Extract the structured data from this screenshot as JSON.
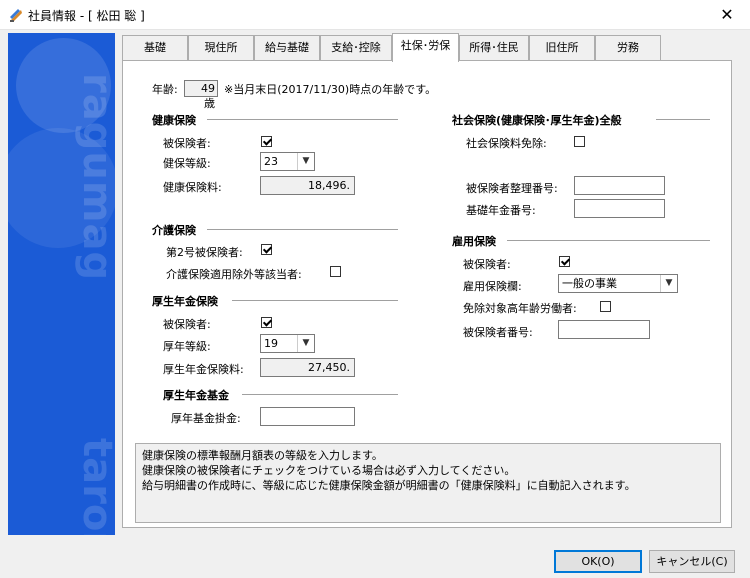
{
  "window": {
    "title": "社員情報 - [ 松田 聡 ]"
  },
  "tabs": [
    "基礎",
    "現住所",
    "給与基礎",
    "支給･控除",
    "社保･労保",
    "所得･住民",
    "旧住所",
    "労務"
  ],
  "age": {
    "label": "年齢:",
    "value": "49",
    "unit": "歳",
    "note": "※当月末日(2017/11/30)時点の年齢です。"
  },
  "health": {
    "title": "健康保険",
    "insured_label": "被保険者:",
    "grade_label": "健保等級:",
    "grade_value": "23",
    "premium_label": "健康保険料:",
    "premium_value": "18,496."
  },
  "care": {
    "title": "介護保険",
    "type2_label": "第2号被保険者:",
    "exempt_label": "介護保険適用除外等該当者:"
  },
  "pension": {
    "title": "厚生年金保険",
    "insured_label": "被保険者:",
    "grade_label": "厚年等級:",
    "grade_value": "19",
    "premium_label": "厚生年金保険料:",
    "premium_value": "27,450."
  },
  "fund": {
    "title": "厚生年金基金",
    "amount_label": "厚年基金掛金:",
    "amount_value": ""
  },
  "social": {
    "title": "社会保険(健康保険･厚生年金)全般",
    "exempt_label": "社会保険料免除:",
    "ref_no_label": "被保険者整理番号:",
    "ref_no_value": "",
    "basic_no_label": "基礎年金番号:",
    "basic_no_value": ""
  },
  "employment": {
    "title": "雇用保険",
    "insured_label": "被保険者:",
    "category_label": "雇用保険欄:",
    "category_value": "一般の事業",
    "elderly_label": "免除対象高年齢労働者:",
    "number_label": "被保険者番号:",
    "number_value": ""
  },
  "description": [
    "健康保険の標準報酬月額表の等級を入力します。",
    "健康保険の被保険者にチェックをつけている場合は必ず入力してください。",
    "給与明細書の作成時に、等級に応じた健康保険金額が明細書の「健康保険料」に自動記入されます。"
  ],
  "buttons": {
    "ok": "OK(O)",
    "cancel": "キャンセル(C)"
  },
  "brand_text": [
    "ragumag",
    "taroru"
  ]
}
